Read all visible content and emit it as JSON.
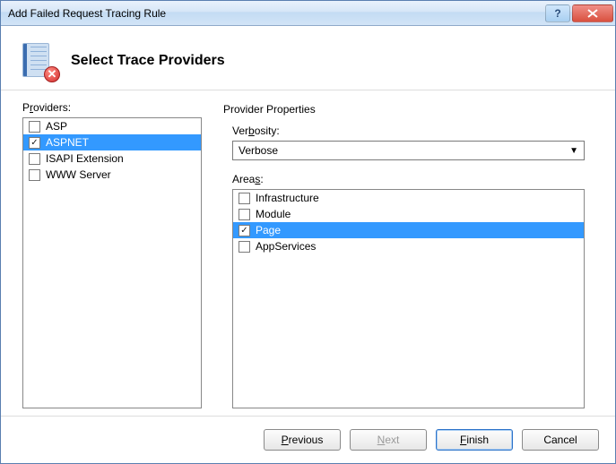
{
  "window": {
    "title": "Add Failed Request Tracing Rule"
  },
  "header": {
    "heading": "Select Trace Providers"
  },
  "providers": {
    "label_pre": "P",
    "label_u": "r",
    "label_post": "oviders:",
    "items": [
      {
        "label": "ASP",
        "checked": false,
        "selected": false
      },
      {
        "label": "ASPNET",
        "checked": true,
        "selected": true
      },
      {
        "label": "ISAPI Extension",
        "checked": false,
        "selected": false
      },
      {
        "label": "WWW Server",
        "checked": false,
        "selected": false
      }
    ]
  },
  "properties": {
    "group_label": "Provider Properties",
    "verbosity_pre": "Ver",
    "verbosity_u": "b",
    "verbosity_post": "osity:",
    "verbosity_value": "Verbose",
    "areas_pre": "Area",
    "areas_u": "s",
    "areas_post": ":",
    "areas": [
      {
        "label": "Infrastructure",
        "checked": false,
        "selected": false
      },
      {
        "label": "Module",
        "checked": false,
        "selected": false
      },
      {
        "label": "Page",
        "checked": true,
        "selected": true
      },
      {
        "label": "AppServices",
        "checked": false,
        "selected": false
      }
    ]
  },
  "buttons": {
    "previous_u": "P",
    "previous_post": "revious",
    "next_u": "N",
    "next_post": "ext",
    "finish_u": "F",
    "finish_post": "inish",
    "cancel": "Cancel"
  }
}
